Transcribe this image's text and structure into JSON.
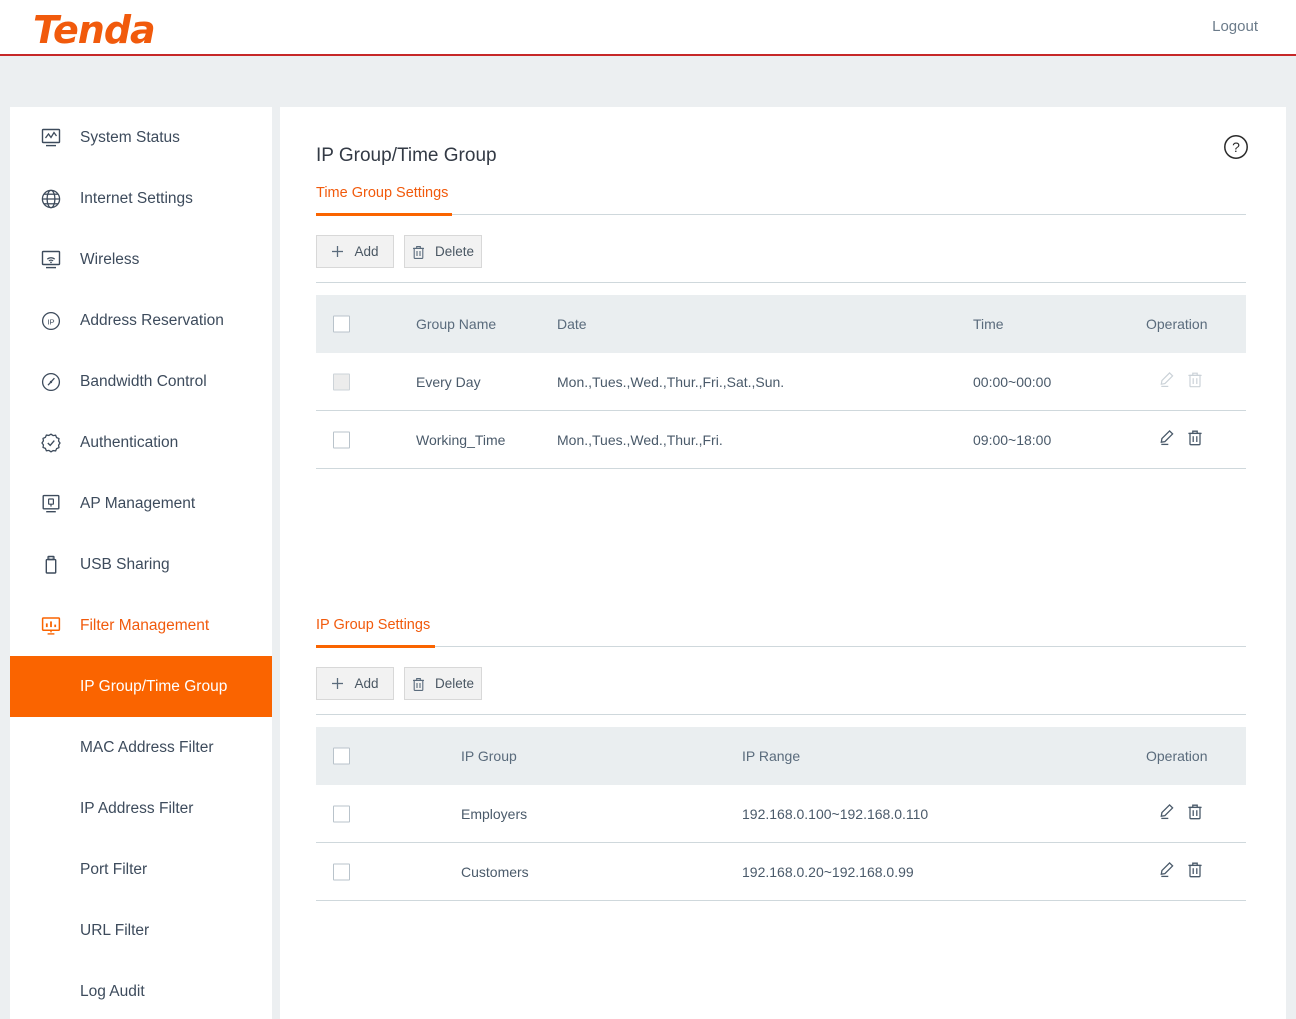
{
  "brand": {
    "name": "Tenda"
  },
  "header": {
    "logout_label": "Logout"
  },
  "page": {
    "title": "IP Group/Time Group",
    "help_icon": "question-circle-icon"
  },
  "sidebar": {
    "items": [
      {
        "label": "System Status",
        "icon": "monitor-chart-icon"
      },
      {
        "label": "Internet Settings",
        "icon": "globe-icon"
      },
      {
        "label": "Wireless",
        "icon": "monitor-wifi-icon"
      },
      {
        "label": "Address Reservation",
        "icon": "ip-circle-icon"
      },
      {
        "label": "Bandwidth Control",
        "icon": "gauge-icon"
      },
      {
        "label": "Authentication",
        "icon": "badge-check-icon"
      },
      {
        "label": "AP Management",
        "icon": "monitor-device-icon"
      },
      {
        "label": "USB Sharing",
        "icon": "usb-stick-icon"
      },
      {
        "label": "Filter Management",
        "icon": "presentation-bars-icon"
      }
    ],
    "subitems": [
      {
        "label": "IP Group/Time Group",
        "active": true
      },
      {
        "label": "MAC Address Filter",
        "active": false
      },
      {
        "label": "IP Address Filter",
        "active": false
      },
      {
        "label": "Port Filter",
        "active": false
      },
      {
        "label": "URL Filter",
        "active": false
      },
      {
        "label": "Log Audit",
        "active": false
      }
    ]
  },
  "time_section": {
    "tab_label": "Time Group Settings",
    "add_label": "Add",
    "delete_label": "Delete",
    "columns": {
      "group_name": "Group Name",
      "date": "Date",
      "time": "Time",
      "operation": "Operation"
    },
    "rows": [
      {
        "group_name": "Every Day",
        "date": "Mon.,Tues.,Wed.,Thur.,Fri.,Sat.,Sun.",
        "time": "00:00~00:00",
        "disabled": true
      },
      {
        "group_name": "Working_Time",
        "date": "Mon.,Tues.,Wed.,Thur.,Fri.",
        "time": "09:00~18:00",
        "disabled": false
      }
    ]
  },
  "ip_section": {
    "tab_label": "IP Group Settings",
    "add_label": "Add",
    "delete_label": "Delete",
    "columns": {
      "ip_group": "IP Group",
      "ip_range": "IP Range",
      "operation": "Operation"
    },
    "rows": [
      {
        "ip_group": "Employers",
        "ip_range": "192.168.0.100~192.168.0.110",
        "disabled": false
      },
      {
        "ip_group": "Customers",
        "ip_range": "192.168.0.20~192.168.0.99",
        "disabled": false
      }
    ]
  },
  "colors": {
    "brand_orange": "#f15a0c",
    "active_orange": "#fa6400",
    "header_rule_red": "#c62828",
    "page_bg": "#eceff1",
    "table_head_bg": "#eaeef0",
    "text": "#4a5a6a"
  }
}
